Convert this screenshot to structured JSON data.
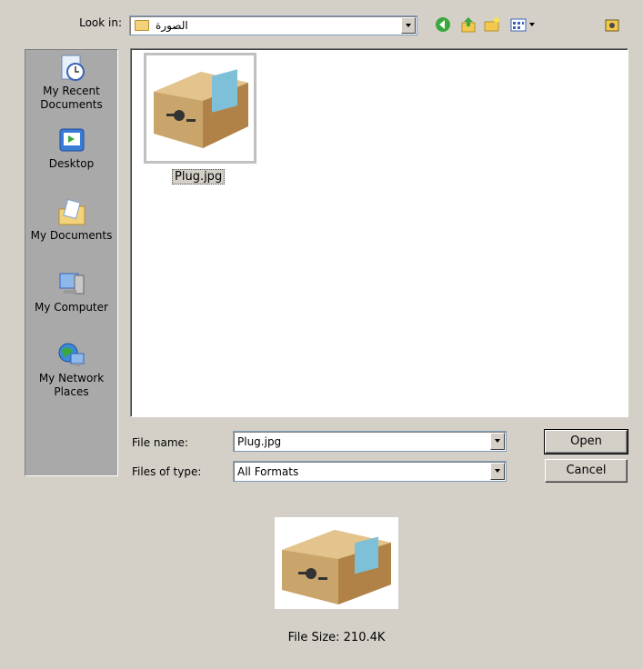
{
  "lookin": {
    "label": "Look in:",
    "folder": "الصورة"
  },
  "toolbar": {
    "icons": [
      "back-icon",
      "up-folder-icon",
      "new-folder-icon",
      "view-menu-icon",
      "desktop-icon"
    ]
  },
  "places": [
    {
      "label": "My Recent Documents",
      "icon": "recent-documents-icon"
    },
    {
      "label": "Desktop",
      "icon": "desktop-icon"
    },
    {
      "label": "My Documents",
      "icon": "my-documents-icon"
    },
    {
      "label": "My Computer",
      "icon": "my-computer-icon"
    },
    {
      "label": "My Network Places",
      "icon": "network-places-icon"
    }
  ],
  "files": [
    {
      "name": "Plug.jpg"
    }
  ],
  "form": {
    "filename_label": "File name:",
    "filename_value": "Plug.jpg",
    "filetype_label": "Files of type:",
    "filetype_value": "All Formats"
  },
  "buttons": {
    "open": "Open",
    "cancel": "Cancel"
  },
  "preview": {
    "file_size": "File Size: 210.4K"
  }
}
